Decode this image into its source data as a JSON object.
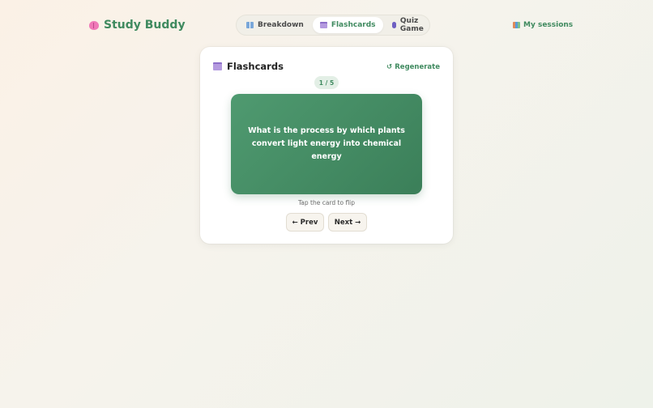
{
  "app": {
    "name": "Study Buddy"
  },
  "nav": {
    "tabs": [
      {
        "label": "Breakdown",
        "icon": "book-icon"
      },
      {
        "label": "Flashcards",
        "icon": "card-box-icon",
        "active": true
      },
      {
        "label": "Quiz Game",
        "icon": "gamepad-icon"
      }
    ],
    "sessions_label": "My sessions"
  },
  "panel": {
    "title": "Flashcards",
    "regenerate_label": "Regenerate",
    "regenerate_icon": "↺",
    "counter": "1 / 5",
    "card_text": "What is the process by which plants convert light energy into chemical energy",
    "hint": "Tap the card to flip",
    "prev_label": "← Prev",
    "next_label": "Next →"
  },
  "colors": {
    "accent": "#3f8a5f",
    "card": "#4a9168",
    "background": "#f6f3ec"
  }
}
